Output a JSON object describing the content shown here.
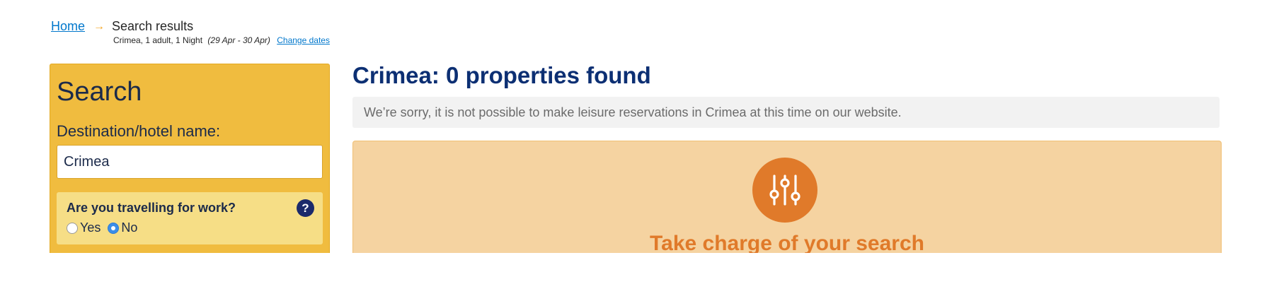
{
  "breadcrumb": {
    "home": "Home",
    "arrow": "→",
    "current": "Search results"
  },
  "search_summary": {
    "text": "Crimea, 1 adult, 1 Night",
    "dates": "(29 Apr - 30 Apr)",
    "change_dates": "Change dates"
  },
  "search_panel": {
    "title": "Search",
    "destination_label": "Destination/hotel name:",
    "destination_value": "Crimea",
    "work_question": "Are you travelling for work?",
    "help_symbol": "?",
    "options": [
      {
        "label": "Yes",
        "selected": false
      },
      {
        "label": "No",
        "selected": true
      }
    ]
  },
  "results": {
    "title": "Crimea: 0 properties found",
    "notice": "We’re sorry, it is not possible to make leisure reservations in Crimea at this time on our website.",
    "promo_title": "Take charge of your search",
    "promo_icon": "sliders-icon"
  },
  "colors": {
    "panel": "#f0bc3f",
    "title_blue": "#0c2f73",
    "promo_bg": "#f5d3a1",
    "promo_accent": "#e07a2a",
    "link": "#0077cc"
  }
}
